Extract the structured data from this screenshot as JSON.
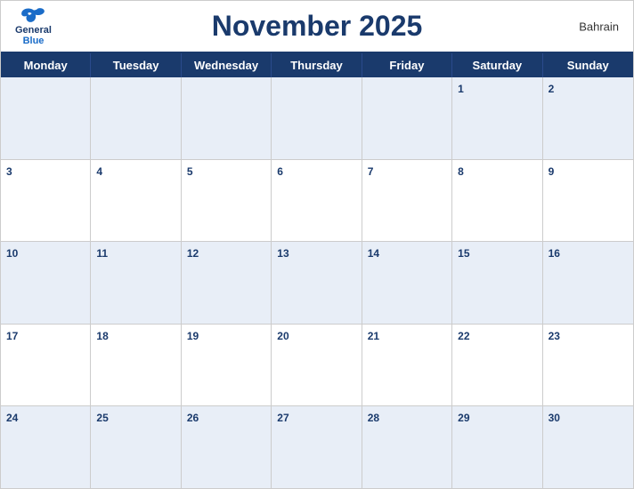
{
  "header": {
    "title": "November 2025",
    "country": "Bahrain",
    "logo": {
      "general": "General",
      "blue": "Blue"
    }
  },
  "days_of_week": [
    "Monday",
    "Tuesday",
    "Wednesday",
    "Thursday",
    "Friday",
    "Saturday",
    "Sunday"
  ],
  "weeks": [
    [
      {
        "day": "",
        "empty": true
      },
      {
        "day": "",
        "empty": true
      },
      {
        "day": "",
        "empty": true
      },
      {
        "day": "",
        "empty": true
      },
      {
        "day": "",
        "empty": true
      },
      {
        "day": "1",
        "empty": false
      },
      {
        "day": "2",
        "empty": false
      }
    ],
    [
      {
        "day": "3",
        "empty": false
      },
      {
        "day": "4",
        "empty": false
      },
      {
        "day": "5",
        "empty": false
      },
      {
        "day": "6",
        "empty": false
      },
      {
        "day": "7",
        "empty": false
      },
      {
        "day": "8",
        "empty": false
      },
      {
        "day": "9",
        "empty": false
      }
    ],
    [
      {
        "day": "10",
        "empty": false
      },
      {
        "day": "11",
        "empty": false
      },
      {
        "day": "12",
        "empty": false
      },
      {
        "day": "13",
        "empty": false
      },
      {
        "day": "14",
        "empty": false
      },
      {
        "day": "15",
        "empty": false
      },
      {
        "day": "16",
        "empty": false
      }
    ],
    [
      {
        "day": "17",
        "empty": false
      },
      {
        "day": "18",
        "empty": false
      },
      {
        "day": "19",
        "empty": false
      },
      {
        "day": "20",
        "empty": false
      },
      {
        "day": "21",
        "empty": false
      },
      {
        "day": "22",
        "empty": false
      },
      {
        "day": "23",
        "empty": false
      }
    ],
    [
      {
        "day": "24",
        "empty": false
      },
      {
        "day": "25",
        "empty": false
      },
      {
        "day": "26",
        "empty": false
      },
      {
        "day": "27",
        "empty": false
      },
      {
        "day": "28",
        "empty": false
      },
      {
        "day": "29",
        "empty": false
      },
      {
        "day": "30",
        "empty": false
      }
    ]
  ],
  "colors": {
    "header_bg": "#1a3a6c",
    "accent": "#1a6cc8",
    "row_odd": "#e8eef7",
    "row_even": "#ffffff"
  }
}
